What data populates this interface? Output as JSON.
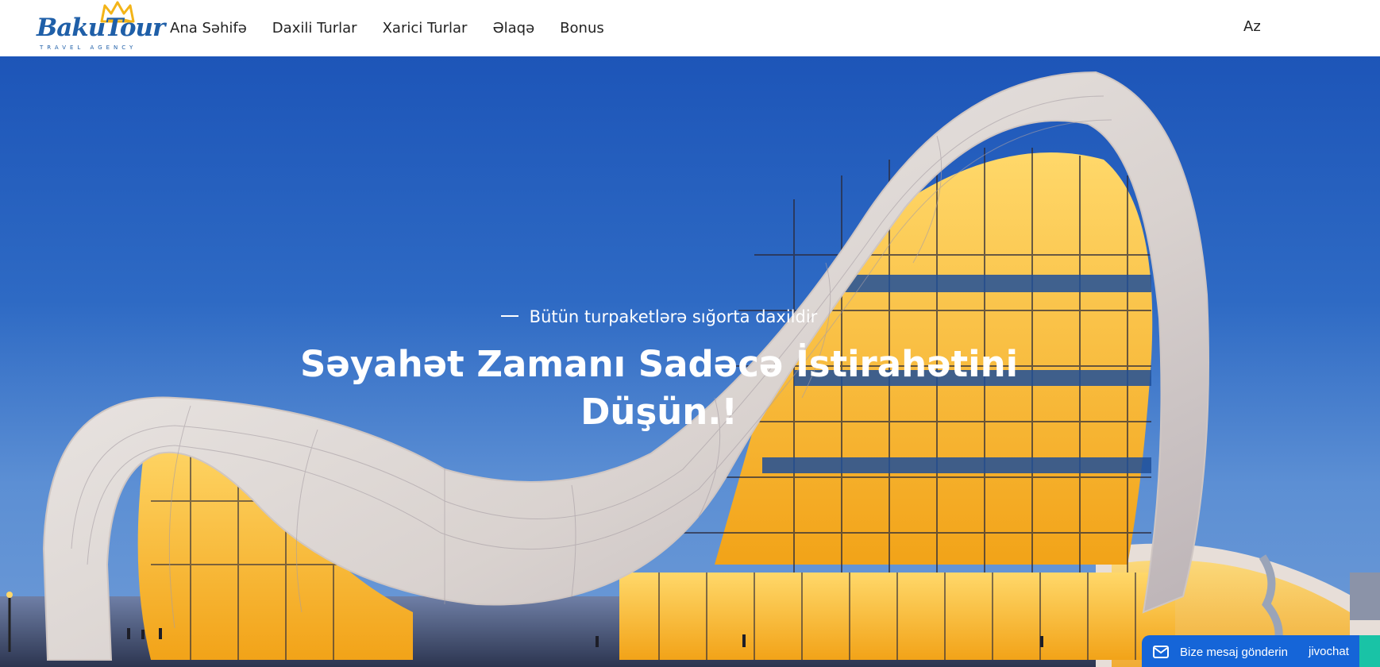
{
  "header": {
    "logo": {
      "script_text": "BakuTour",
      "subtitle": "TRAVEL AGENCY",
      "crown_icon": "crown-icon"
    },
    "nav": [
      {
        "label": "Ana Səhifə"
      },
      {
        "label": "Daxili Turlar"
      },
      {
        "label": "Xarici Turlar"
      },
      {
        "label": "Əlaqə"
      },
      {
        "label": "Bonus"
      }
    ],
    "language": "Az"
  },
  "hero": {
    "tagline": "Bütün turpaketlərə sığorta daxildir",
    "headline": "Səyahət Zamanı Sadəcə İstirahətini Düşün.!"
  },
  "chat_widget": {
    "label": "Bize mesaj gönderin",
    "brand": "jivochat",
    "icon": "envelope-icon"
  },
  "colors": {
    "brand_blue": "#1f5fa8",
    "crown_gold": "#f3b418",
    "chat_blue": "#1565d8",
    "chat_teal": "#19c3a6"
  }
}
